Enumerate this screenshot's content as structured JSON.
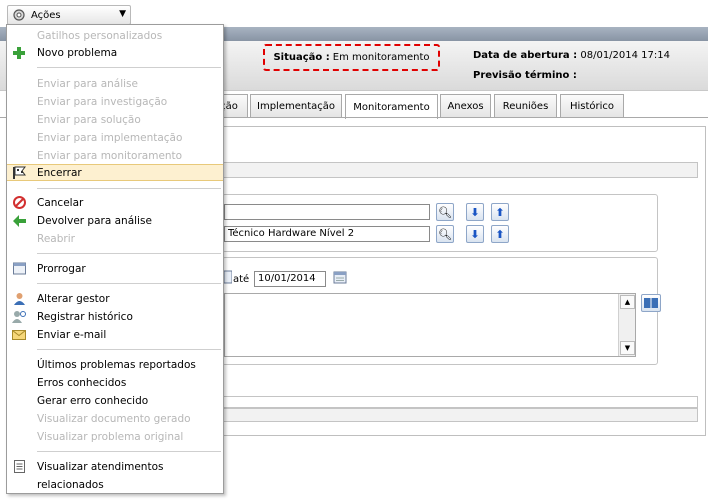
{
  "actions_button": {
    "label": "Ações",
    "icon": "gear-icon"
  },
  "header": {
    "situacao_label": "Situação :",
    "situacao_value": "Em monitoramento",
    "data_abertura_label": "Data de abertura :",
    "data_abertura_value": "08/01/2014 17:14",
    "previsao_label": "Previsão término :"
  },
  "tabs": [
    "ção",
    "Implementação",
    "Monitoramento",
    "Anexos",
    "Reuniões",
    "Histórico"
  ],
  "active_tab": "Monitoramento",
  "form": {
    "grupo_value": "Técnico Hardware Nível 2",
    "ate_label": "até",
    "date_end": "10/01/2014"
  },
  "menu": {
    "gatilhos": "Gatilhos personalizados",
    "novo_problema": "Novo problema",
    "enviar_analise": "Enviar para análise",
    "enviar_investigacao": "Enviar para investigação",
    "enviar_solucao": "Enviar para solução",
    "enviar_implementacao": "Enviar para implementação",
    "enviar_monitoramento": "Enviar para monitoramento",
    "encerrar": "Encerrar",
    "cancelar": "Cancelar",
    "devolver_analise": "Devolver para análise",
    "reabrir": "Reabrir",
    "prorrogar": "Prorrogar",
    "alterar_gestor": "Alterar gestor",
    "registrar_historico": "Registrar histórico",
    "enviar_email": "Enviar e-mail",
    "ultimos_problemas": "Últimos problemas reportados",
    "erros_conhecidos": "Erros conhecidos",
    "gerar_erro": "Gerar erro conhecido",
    "visualizar_documento": "Visualizar documento gerado",
    "visualizar_problema": "Visualizar problema original",
    "visualizar_atendimentos": "Visualizar atendimentos",
    "relacionados": "relacionados"
  }
}
